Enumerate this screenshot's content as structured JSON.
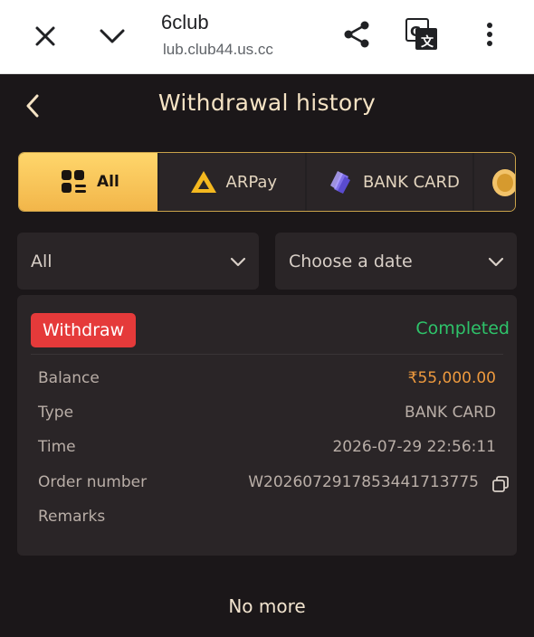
{
  "browser": {
    "site_title": "6club",
    "url": "lub.club44.us.cc",
    "icons": [
      "close-icon",
      "chevron-down-icon",
      "share-icon",
      "translate-icon",
      "more-vert-icon"
    ]
  },
  "header": {
    "title": "Withdrawal history"
  },
  "tabs": [
    {
      "label": "All",
      "icon": "grid-list-icon",
      "active": true
    },
    {
      "label": "ARPay",
      "icon": "arpay-logo-icon",
      "active": false
    },
    {
      "label": "BANK CARD",
      "icon": "bank-card-icon",
      "active": false
    }
  ],
  "filters": {
    "status": {
      "value": "All"
    },
    "date": {
      "placeholder": "Choose a date"
    }
  },
  "record": {
    "badge": "Withdraw",
    "status": "Completed",
    "rows": {
      "balance": {
        "label": "Balance",
        "value": "₹55,000.00"
      },
      "type": {
        "label": "Type",
        "value": "BANK CARD"
      },
      "time": {
        "label": "Time",
        "value": "2026-07-29 22:56:11"
      },
      "order": {
        "label": "Order number",
        "value": "W2026072917853441713775"
      },
      "remarks": {
        "label": "Remarks",
        "value": ""
      }
    }
  },
  "footer": {
    "no_more": "No more"
  },
  "colors": {
    "background": "#1b1719",
    "panel": "#2a2527",
    "accent_gold": "#f2b64a",
    "badge_red": "#e53a3a",
    "status_green": "#2ec36a",
    "amount_orange": "#ee9a3e"
  }
}
